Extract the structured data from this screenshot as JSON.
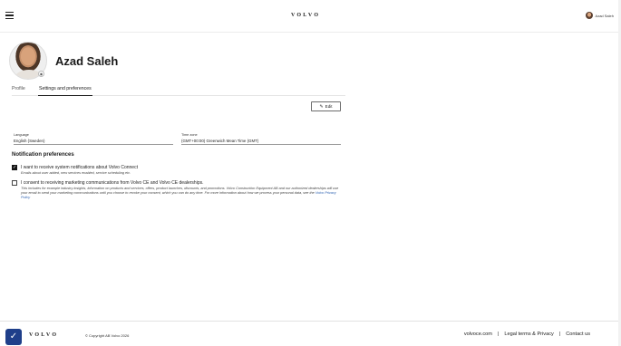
{
  "header": {
    "brand": "VOLVO",
    "user_name": "Azad Saleh",
    "menu_icon": "hamburger-menu-icon",
    "avatar_icon": "user-avatar-icon"
  },
  "profile": {
    "name": "Azad Saleh",
    "camera_icon": "camera-icon"
  },
  "tabs": [
    {
      "label": "Profile",
      "active": false
    },
    {
      "label": "Settings and preferences",
      "active": true
    }
  ],
  "edit": {
    "label": "Edit",
    "icon": "pencil-icon"
  },
  "settings": {
    "language": {
      "label": "Language",
      "value": "English (Sweden)"
    },
    "timezone": {
      "label": "Time zone",
      "value": "(GMT+00:00) Greenwich Mean Time (GMT)"
    }
  },
  "notifications": {
    "title": "Notification preferences",
    "items": [
      {
        "checked": true,
        "label": "I want to receive system notifications about Volvo Connect",
        "description": "Emails about user added, new services enabled, service scheduling etc."
      },
      {
        "checked": false,
        "label": "I consent to receiving marketing communications from Volvo CE and Volvo CE dealerships.",
        "description": "This includes for example industry insights, information on products and services, offers, product launches, discounts, and promotions. Volvo Construction Equipment AB and our authorized dealerships will use your email to send your marketing communications until you choose to revoke your consent, which you can do any time. For more information about how we process your personal data, see the",
        "link": "Volvo Privacy Policy"
      }
    ]
  },
  "footer": {
    "brand": "VOLVO",
    "copyright": "© Copyright AB Volvo 2026",
    "links": [
      "volvoce.com",
      "Legal terms & Privacy",
      "Contact us"
    ],
    "separator": "|",
    "privacy_icon": "shield-check-icon"
  },
  "colors": {
    "accent_dark": "#141414",
    "privacy_button": "#1f3f8a",
    "link": "#2a5fb0"
  }
}
